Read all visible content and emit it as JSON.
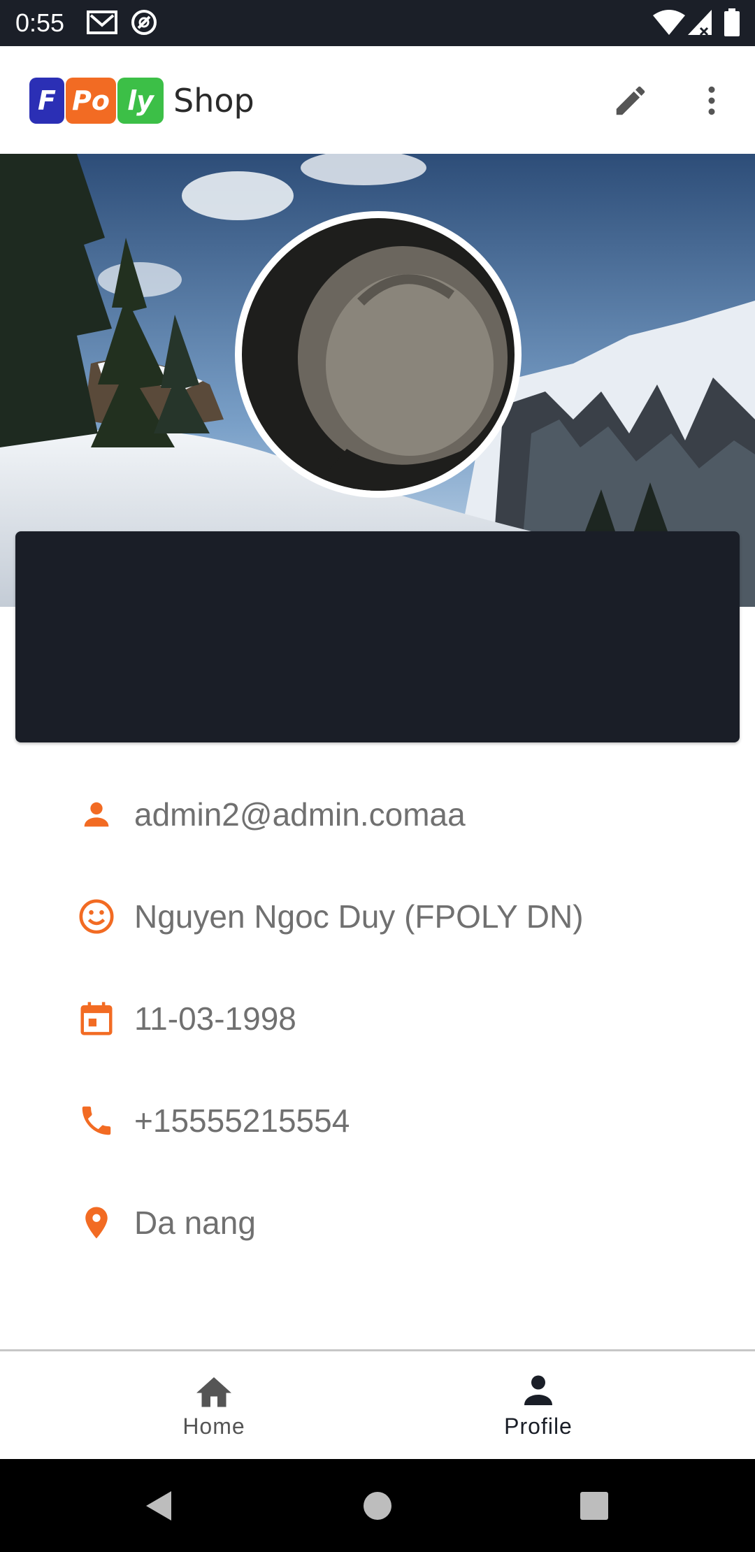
{
  "status_bar": {
    "time": "0:55",
    "icons": [
      "gmail-icon",
      "at-sign-icon",
      "wifi-icon",
      "signal-icon",
      "battery-icon"
    ]
  },
  "app_bar": {
    "logo_letters": [
      "F",
      "Po",
      "ly"
    ],
    "title": "Shop",
    "logo_colors": [
      "#2b2fb5",
      "#f26b23",
      "#3cbf47"
    ],
    "actions": [
      "edit-icon",
      "more-vert-icon"
    ]
  },
  "profile": {
    "email": "admin2@admin.comaa",
    "full_name": "Nguyen Ngoc Duy (FPOLY DN)",
    "birthday": "11-03-1998",
    "phone": "+15555215554",
    "address": "Da nang",
    "accent_color": "#f26b23"
  },
  "bottom_nav": {
    "items": [
      {
        "label": "Home",
        "icon": "home-icon",
        "selected": false
      },
      {
        "label": "Profile",
        "icon": "person-icon",
        "selected": true
      }
    ]
  },
  "system_nav": [
    "back-icon",
    "home-circle-icon",
    "recents-icon"
  ]
}
